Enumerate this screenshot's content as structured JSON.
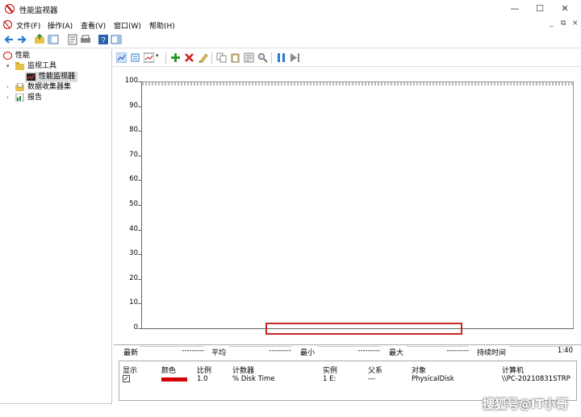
{
  "window": {
    "title": "性能监视器",
    "minimize": "—",
    "maximize": "☐",
    "close": "✕"
  },
  "menubar": {
    "items": [
      "文件(F)",
      "操作(A)",
      "查看(V)",
      "窗口(W)",
      "帮助(H)"
    ],
    "mdi_minimize": "_",
    "mdi_restore": "⧉",
    "mdi_close": "×"
  },
  "tree": {
    "root": "性能",
    "monitoring_tools": "监视工具",
    "performance_monitor": "性能监视器",
    "data_collector_sets": "数据收集器集",
    "reports": "报告"
  },
  "graph": {
    "y_ticks": [
      "100",
      "90",
      "80",
      "70",
      "60",
      "50",
      "40",
      "30",
      "20",
      "10",
      "0"
    ]
  },
  "stats": {
    "last_label": "最新",
    "last_value": "---------",
    "avg_label": "平均",
    "avg_value": "---------",
    "min_label": "最小",
    "min_value": "---------",
    "max_label": "最大",
    "max_value": "---------",
    "duration_label": "持续时间",
    "duration_value": "1:40"
  },
  "counters": {
    "headers": [
      "显示",
      "颜色",
      "比例",
      "计数器",
      "实例",
      "父系",
      "对象",
      "计算机"
    ],
    "rows": [
      {
        "show": "✓",
        "color": "#d40000",
        "scale": "1.0",
        "counter": "% Disk Time",
        "instance": "1 E:",
        "parent": "---",
        "object": "PhysicalDisk",
        "computer": "\\\\PC-20210831STRP"
      }
    ]
  },
  "watermark": "搜狐号@IT小哥",
  "colors": {
    "highlight": "#c62828",
    "series": "#d40000"
  }
}
